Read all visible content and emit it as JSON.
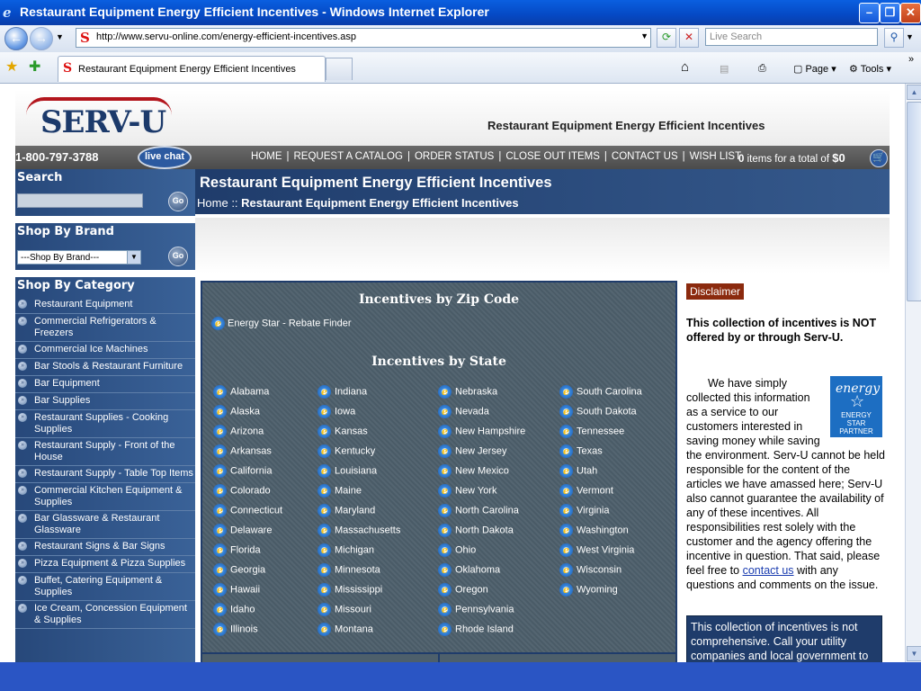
{
  "browser": {
    "window_title": "Restaurant Equipment Energy Efficient Incentives - Windows Internet Explorer",
    "url": "http://www.servu-online.com/energy-efficient-incentives.asp",
    "search_placeholder": "Live Search",
    "tab_title": "Restaurant Equipment Energy Efficient Incentives",
    "toolbar": {
      "page": "Page",
      "tools": "Tools"
    }
  },
  "header": {
    "logo_text": "SERV-U",
    "title": "Restaurant Equipment Energy Efficient Incentives"
  },
  "topnav": {
    "phone": "1-800-797-3788",
    "live_chat": "live chat",
    "links": [
      "HOME",
      "REQUEST A CATALOG",
      "ORDER STATUS",
      "CLOSE OUT ITEMS",
      "CONTACT US",
      "WISH LIST"
    ],
    "cart_count": "0",
    "cart_text": "items for a total of",
    "cart_total": "$0"
  },
  "sidebar": {
    "search_heading": "Search",
    "go_label": "Go",
    "brand_heading": "Shop By Brand",
    "brand_select": "---Shop By Brand---",
    "category_heading": "Shop By Category",
    "categories": [
      "Restaurant Equipment",
      "Commercial Refrigerators & Freezers",
      "Commercial Ice Machines",
      "Bar Stools & Restaurant Furniture",
      "Bar Equipment",
      "Bar Supplies",
      "Restaurant Supplies - Cooking Supplies",
      "Restaurant Supply - Front of the House",
      "Restaurant Supply - Table Top Items",
      "Commercial Kitchen Equipment & Supplies",
      "Bar Glassware & Restaurant Glassware",
      "Restaurant Signs & Bar Signs",
      "Pizza Equipment & Pizza Supplies",
      "Buffet, Catering Equipment & Supplies",
      "Ice Cream, Concession Equipment & Supplies"
    ]
  },
  "main": {
    "page_title": "Restaurant Equipment Energy Efficient Incentives",
    "breadcrumb_home": "Home",
    "breadcrumb_sep": "::",
    "breadcrumb_current": "Restaurant Equipment Energy Efficient Incentives",
    "zip_heading": "Incentives by Zip Code",
    "rebate_link": "Energy Star - Rebate Finder",
    "state_heading": "Incentives by State",
    "states_col1": [
      "Alabama",
      "Alaska",
      "Arizona",
      "Arkansas",
      "California",
      "Colorado",
      "Connecticut",
      "Delaware",
      "Florida",
      "Georgia",
      "Hawaii",
      "Idaho",
      "Illinois"
    ],
    "states_col2": [
      "Indiana",
      "Iowa",
      "Kansas",
      "Kentucky",
      "Louisiana",
      "Maine",
      "Maryland",
      "Massachusetts",
      "Michigan",
      "Minnesota",
      "Mississippi",
      "Missouri",
      "Montana"
    ],
    "states_col3": [
      "Nebraska",
      "Nevada",
      "New Hampshire",
      "New Jersey",
      "New Mexico",
      "New York",
      "North Carolina",
      "North Dakota",
      "Ohio",
      "Oklahoma",
      "Oregon",
      "Pennsylvania",
      "Rhode Island"
    ],
    "states_col4": [
      "South Carolina",
      "South Dakota",
      "Tennessee",
      "Texas",
      "Utah",
      "Vermont",
      "Virginia",
      "Washington",
      "West Virginia",
      "Wisconsin",
      "Wyoming"
    ]
  },
  "disclaimer": {
    "button": "Disclaimer",
    "bold": "This collection of incentives is NOT offered by or through Serv-U.",
    "body_before_link": "We have simply collected this information as a service to our customers interested in saving money while saving the environment. Serv-U cannot be held responsible for the content of the articles we have amassed here; Serv-U also cannot guarantee the availability of any of these incentives. All responsibilities rest solely with the customer and the agency offering the incentive in question. That said, please feel free to",
    "link": "contact us",
    "body_after_link": "with any questions and comments on the issue.",
    "energy_star_script": "energy",
    "energy_star_partner": "ENERGY STAR PARTNER",
    "note": "This collection of incentives is not comprehensive. Call your utility companies and local government to"
  }
}
